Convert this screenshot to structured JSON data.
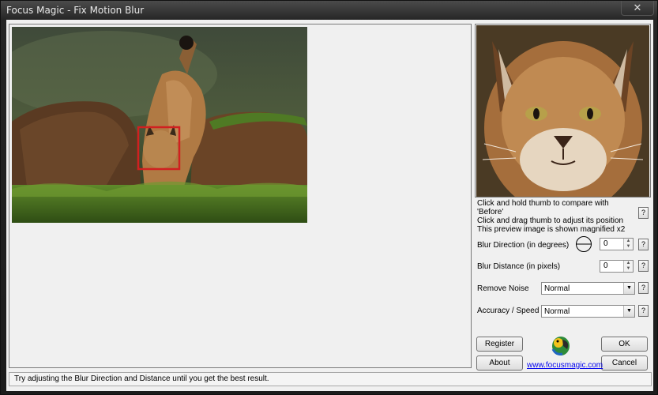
{
  "window": {
    "title": "Focus Magic - Fix Motion Blur",
    "close_glyph": "✕"
  },
  "main": {
    "image_alt": "Lynx photo with selection rectangle"
  },
  "preview": {
    "hints": [
      "Click and hold thumb to compare with 'Before'",
      "Click and drag thumb to adjust its position",
      "This preview image is shown magnified x2"
    ]
  },
  "controls": {
    "blur_direction_label": "Blur Direction (in degrees)",
    "blur_direction_value": "0",
    "blur_distance_label": "Blur Distance (in pixels)",
    "blur_distance_value": "0",
    "remove_noise_label": "Remove Noise",
    "remove_noise_value": "Normal",
    "accuracy_label": "Accuracy / Speed",
    "accuracy_value": "Normal",
    "help": "?"
  },
  "buttons": {
    "register": "Register",
    "ok": "OK",
    "about": "About",
    "cancel": "Cancel"
  },
  "link": "www.focusmagic.com",
  "status": "Try adjusting the Blur Direction and Distance until you get the best result.",
  "icons": {
    "help": "help-icon",
    "direction": "direction-dial-icon",
    "logo": "parrot-logo"
  },
  "colors": {
    "selection": "#d02020",
    "link": "#0000ee"
  }
}
